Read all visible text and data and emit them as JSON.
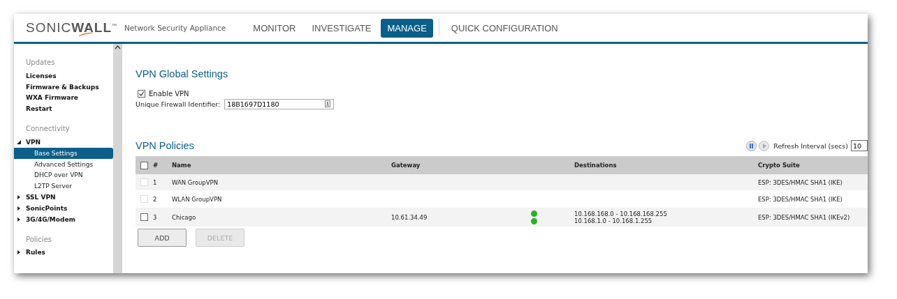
{
  "header": {
    "logo": "SONIC**WALL**$^{™}$",
    "product": "Network Security Appliance",
    "nav": [
      {
        "label": "MONITOR",
        "selected": false
      },
      {
        "label": "INVESTIGATE",
        "selected": false
      },
      {
        "label": "MANAGE",
        "selected": true
      },
      {
        "label": "QUICK CONFIGURATION",
        "selected": false
      }
    ]
  },
  "sidebar": {
    "sections": [
      {
        "title": "Updates",
        "items": [
          {
            "label": "Licenses",
            "kind": "link"
          },
          {
            "label": "Firmware & Backups",
            "kind": "link"
          },
          {
            "label": "WXA Firmware",
            "kind": "link"
          },
          {
            "label": "Restart",
            "kind": "link"
          }
        ]
      },
      {
        "title": "Connectivity",
        "items": [
          {
            "label": "VPN",
            "kind": "group",
            "expanded": true,
            "children": [
              {
                "label": "Base Settings",
                "selected": true
              },
              {
                "label": "Advanced Settings",
                "selected": false
              },
              {
                "label": "DHCP over VPN",
                "selected": false
              },
              {
                "label": "L2TP Server",
                "selected": false
              }
            ]
          },
          {
            "label": "SSL VPN",
            "kind": "group",
            "expanded": false
          },
          {
            "label": "SonicPoints",
            "kind": "group",
            "expanded": false
          },
          {
            "label": "3G/4G/Modem",
            "kind": "group",
            "expanded": false
          }
        ]
      },
      {
        "title": "Policies",
        "items": [
          {
            "label": "Rules",
            "kind": "group",
            "expanded": false
          }
        ]
      }
    ]
  },
  "global_settings": {
    "title": "VPN Global Settings",
    "enable_vpn": {
      "label": "Enable VPN",
      "checked": true
    },
    "identifier": {
      "label": "Unique Firewall Identifier:",
      "value": "18B1697D1180"
    }
  },
  "policies": {
    "title": "VPN Policies",
    "refresh_label": "Refresh Interval (secs)",
    "refresh_value": "10",
    "select_all_checked": false,
    "columns": [
      "#",
      "Name",
      "Gateway",
      "Destinations",
      "Crypto Suite"
    ],
    "rows": [
      {
        "number": "1",
        "name": "WAN GroupVPN",
        "gateway": "",
        "destinations": [],
        "crypto": "ESP: 3DES/HMAC SHA1 (IKE)",
        "checked": false,
        "disabled": true
      },
      {
        "number": "2",
        "name": "WLAN GroupVPN",
        "gateway": "",
        "destinations": [],
        "crypto": "ESP: 3DES/HMAC SHA1 (IKE)",
        "checked": false,
        "disabled": true
      },
      {
        "number": "3",
        "name": "Chicago",
        "gateway": "10.61.34.49",
        "destinations": [
          {
            "range": "10.168.168.0 - 10.168.168.255",
            "connected": true
          },
          {
            "range": "10.168.1.0 - 10.168.1.255",
            "connected": true
          }
        ],
        "crypto": "ESP: 3DES/HMAC SHA1 (IKEv2)",
        "checked": false,
        "disabled": false
      }
    ],
    "buttons": [
      {
        "label": "ADD",
        "disabled": false
      },
      {
        "label": "DELETE",
        "disabled": true
      }
    ]
  }
}
